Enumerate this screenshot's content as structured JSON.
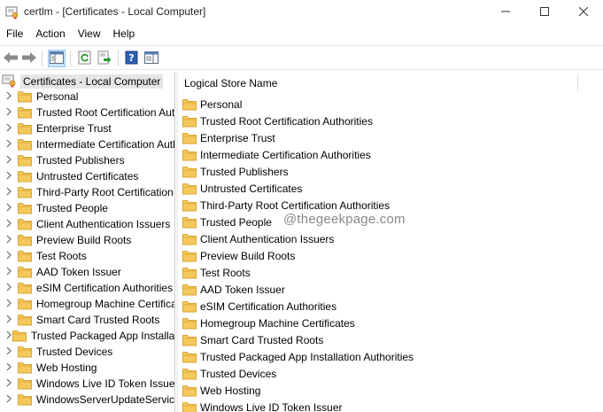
{
  "window": {
    "title": "certlm - [Certificates - Local Computer]",
    "icon": "certificate-console-icon",
    "controls": [
      "minimize-icon",
      "maximize-icon",
      "close-icon"
    ]
  },
  "menu": {
    "items": [
      "File",
      "Action",
      "View",
      "Help"
    ]
  },
  "toolbar": {
    "buttons": [
      "back-arrow-icon",
      "forward-arrow-icon",
      "show-hide-console-tree-icon",
      "refresh-icon",
      "export-list-icon",
      "help-icon",
      "properties-pane-icon"
    ]
  },
  "tree": {
    "root_label": "Certificates - Local Computer",
    "items": [
      "Personal",
      "Trusted Root Certification Authorities",
      "Enterprise Trust",
      "Intermediate Certification Authorities",
      "Trusted Publishers",
      "Untrusted Certificates",
      "Third-Party Root Certification Authorities",
      "Trusted People",
      "Client Authentication Issuers",
      "Preview Build Roots",
      "Test Roots",
      "AAD Token Issuer",
      "eSIM Certification Authorities",
      "Homegroup Machine Certificates",
      "Smart Card Trusted Roots",
      "Trusted Packaged App Installation Authorities",
      "Trusted Devices",
      "Web Hosting",
      "Windows Live ID Token Issuer",
      "WindowsServerUpdateServices"
    ]
  },
  "content": {
    "column_header": "Logical Store Name",
    "items": [
      "Personal",
      "Trusted Root Certification Authorities",
      "Enterprise Trust",
      "Intermediate Certification Authorities",
      "Trusted Publishers",
      "Untrusted Certificates",
      "Third-Party Root Certification Authorities",
      "Trusted People",
      "Client Authentication Issuers",
      "Preview Build Roots",
      "Test Roots",
      "AAD Token Issuer",
      "eSIM Certification Authorities",
      "Homegroup Machine Certificates",
      "Smart Card Trusted Roots",
      "Trusted Packaged App Installation Authorities",
      "Trusted Devices",
      "Web Hosting",
      "Windows Live ID Token Issuer"
    ]
  },
  "watermark": "@thegeekpage.com",
  "colors": {
    "folder_fill": "#f5c85b",
    "folder_edge": "#d9a633",
    "selection": "#e5e5e5"
  }
}
